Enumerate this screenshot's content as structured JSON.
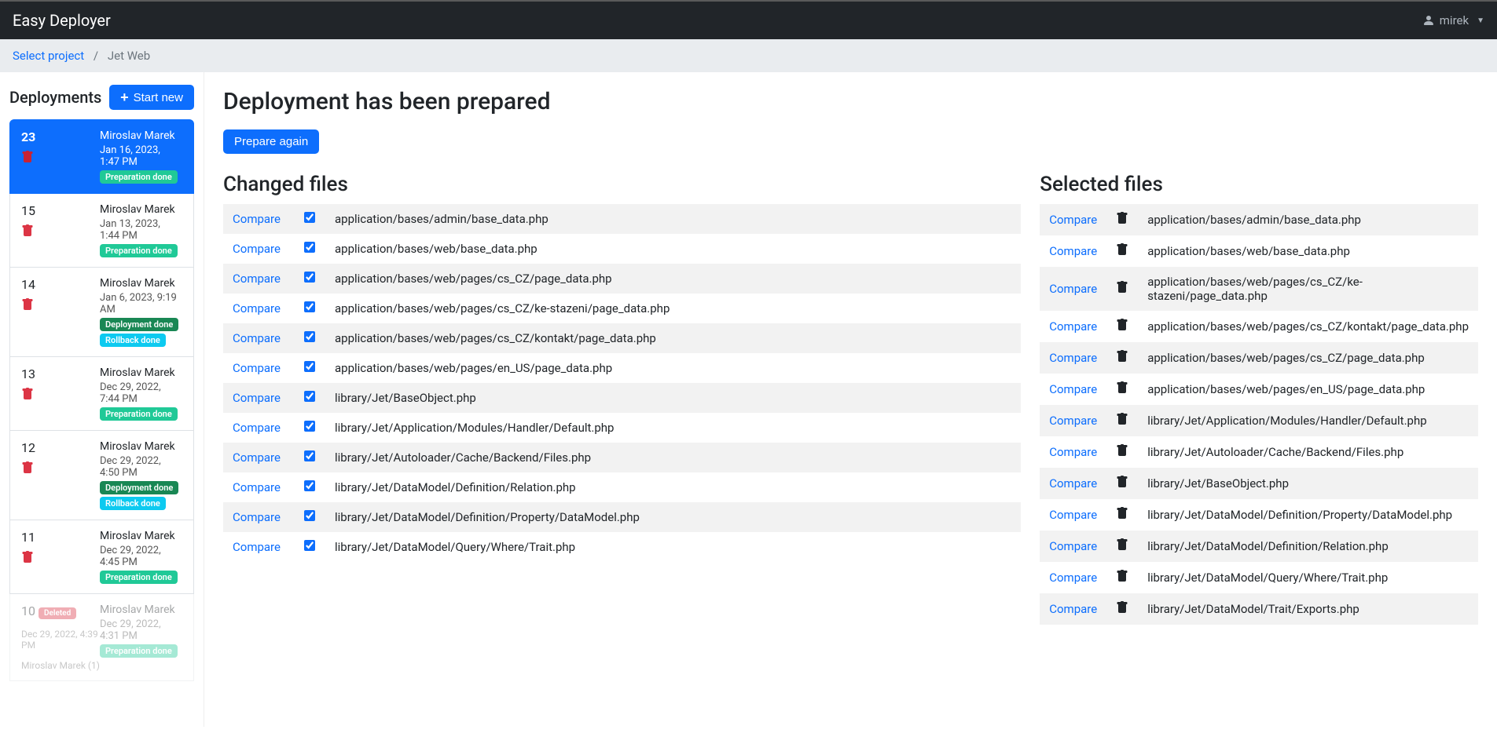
{
  "navbar": {
    "brand": "Easy Deployer",
    "user": "mirek"
  },
  "breadcrumb": {
    "link": "Select project",
    "active": "Jet Web"
  },
  "sidebar": {
    "title": "Deployments",
    "start_new": "Start new",
    "items": [
      {
        "num": "23",
        "author": "Miroslav Marek",
        "date": "Jan 16, 2023, 1:47 PM",
        "badges": [
          "Preparation done"
        ],
        "badge_types": [
          "prep"
        ],
        "active": true
      },
      {
        "num": "15",
        "author": "Miroslav Marek",
        "date": "Jan 13, 2023, 1:44 PM",
        "badges": [
          "Preparation done"
        ],
        "badge_types": [
          "prep"
        ]
      },
      {
        "num": "14",
        "author": "Miroslav Marek",
        "date": "Jan 6, 2023, 9:19 AM",
        "badges": [
          "Deployment done",
          "Rollback done"
        ],
        "badge_types": [
          "deploy",
          "rollback"
        ]
      },
      {
        "num": "13",
        "author": "Miroslav Marek",
        "date": "Dec 29, 2022, 7:44 PM",
        "badges": [
          "Preparation done"
        ],
        "badge_types": [
          "prep"
        ]
      },
      {
        "num": "12",
        "author": "Miroslav Marek",
        "date": "Dec 29, 2022, 4:50 PM",
        "badges": [
          "Deployment done",
          "Rollback done"
        ],
        "badge_types": [
          "deploy",
          "rollback"
        ]
      },
      {
        "num": "11",
        "author": "Miroslav Marek",
        "date": "Dec 29, 2022, 4:45 PM",
        "badges": [
          "Preparation done"
        ],
        "badge_types": [
          "prep"
        ]
      },
      {
        "num": "10",
        "author": "Miroslav Marek",
        "date": "Dec 29, 2022, 4:31 PM",
        "badges": [
          "Preparation done"
        ],
        "badge_types": [
          "prep"
        ],
        "faded": true,
        "deleted_label": "Deleted",
        "extra": "Dec 29, 2022, 4:39 PM",
        "extra2": "Miroslav Marek (1)"
      }
    ]
  },
  "main": {
    "title": "Deployment has been prepared",
    "prepare_again": "Prepare again",
    "changed_title": "Changed files",
    "selected_title": "Selected files",
    "compare_label": "Compare",
    "changed_files": [
      "application/bases/admin/base_data.php",
      "application/bases/web/base_data.php",
      "application/bases/web/pages/cs_CZ/page_data.php",
      "application/bases/web/pages/cs_CZ/ke-stazeni/page_data.php",
      "application/bases/web/pages/cs_CZ/kontakt/page_data.php",
      "application/bases/web/pages/en_US/page_data.php",
      "library/Jet/BaseObject.php",
      "library/Jet/Application/Modules/Handler/Default.php",
      "library/Jet/Autoloader/Cache/Backend/Files.php",
      "library/Jet/DataModel/Definition/Relation.php",
      "library/Jet/DataModel/Definition/Property/DataModel.php",
      "library/Jet/DataModel/Query/Where/Trait.php"
    ],
    "selected_files": [
      "application/bases/admin/base_data.php",
      "application/bases/web/base_data.php",
      "application/bases/web/pages/cs_CZ/ke-stazeni/page_data.php",
      "application/bases/web/pages/cs_CZ/kontakt/page_data.php",
      "application/bases/web/pages/cs_CZ/page_data.php",
      "application/bases/web/pages/en_US/page_data.php",
      "library/Jet/Application/Modules/Handler/Default.php",
      "library/Jet/Autoloader/Cache/Backend/Files.php",
      "library/Jet/BaseObject.php",
      "library/Jet/DataModel/Definition/Property/DataModel.php",
      "library/Jet/DataModel/Definition/Relation.php",
      "library/Jet/DataModel/Query/Where/Trait.php",
      "library/Jet/DataModel/Trait/Exports.php"
    ]
  }
}
